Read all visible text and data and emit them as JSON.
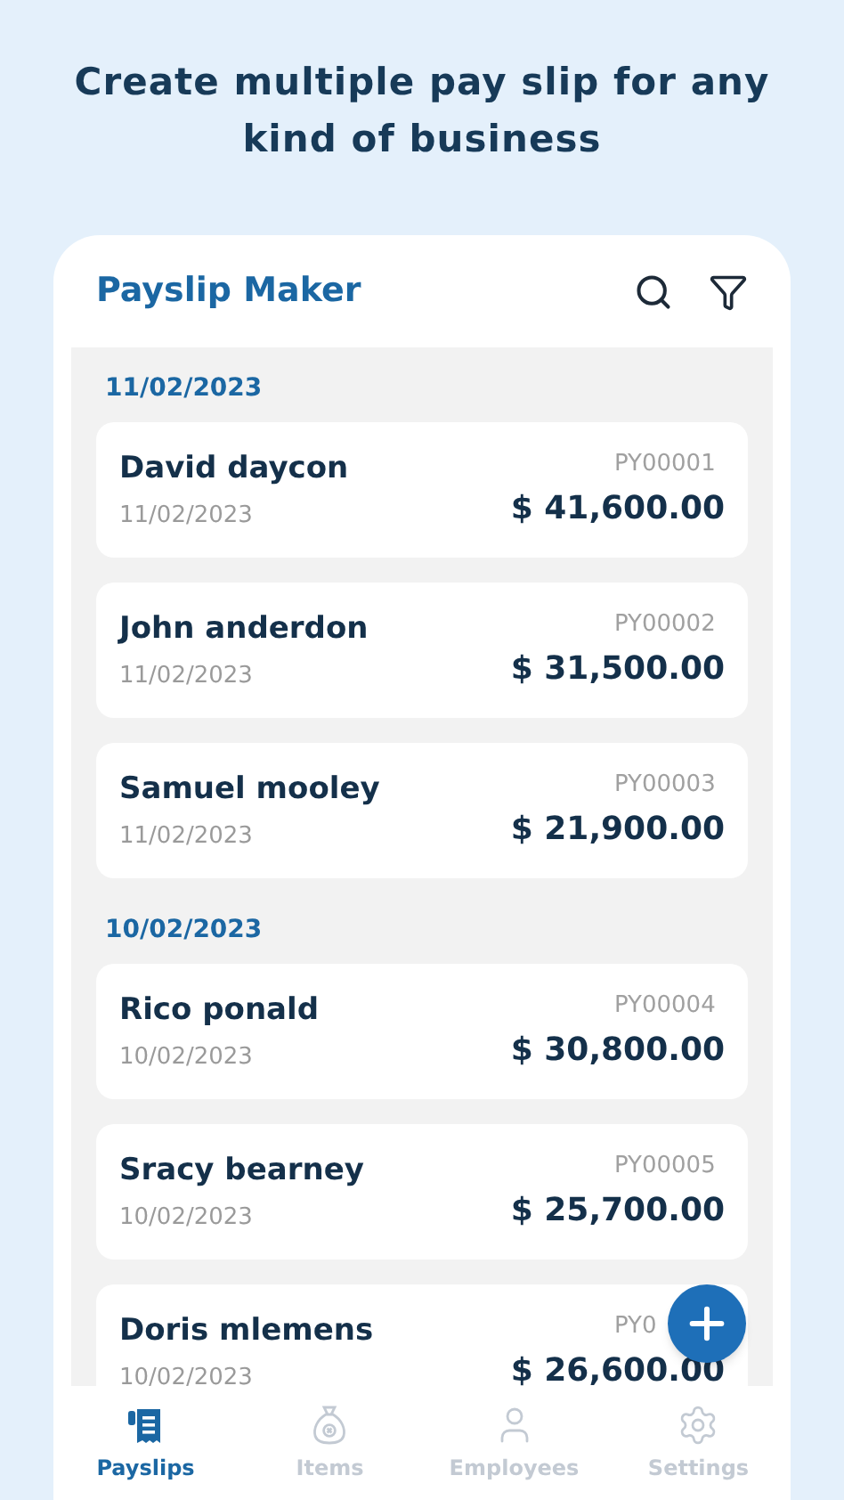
{
  "headline": "Create multiple pay slip for any kind of business",
  "app_bar": {
    "title": "Payslip Maker"
  },
  "groups": [
    {
      "date": "11/02/2023",
      "slips": [
        {
          "name": "David daycon",
          "date": "11/02/2023",
          "number": "PY00001",
          "amount": "$ 41,600.00"
        },
        {
          "name": "John anderdon",
          "date": "11/02/2023",
          "number": "PY00002",
          "amount": "$ 31,500.00"
        },
        {
          "name": "Samuel mooley",
          "date": "11/02/2023",
          "number": "PY00003",
          "amount": "$ 21,900.00"
        }
      ]
    },
    {
      "date": "10/02/2023",
      "slips": [
        {
          "name": "Rico ponald",
          "date": "10/02/2023",
          "number": "PY00004",
          "amount": "$ 30,800.00"
        },
        {
          "name": "Sracy bearney",
          "date": "10/02/2023",
          "number": "PY00005",
          "amount": "$ 25,700.00"
        },
        {
          "name": "Doris mlemens",
          "date": "10/02/2023",
          "number": "PY0",
          "amount": "$ 26,600.00"
        }
      ]
    }
  ],
  "bottom_nav": [
    {
      "label": "Payslips",
      "selected": true
    },
    {
      "label": "Items",
      "selected": false
    },
    {
      "label": "Employees",
      "selected": false
    },
    {
      "label": "Settings",
      "selected": false
    }
  ]
}
